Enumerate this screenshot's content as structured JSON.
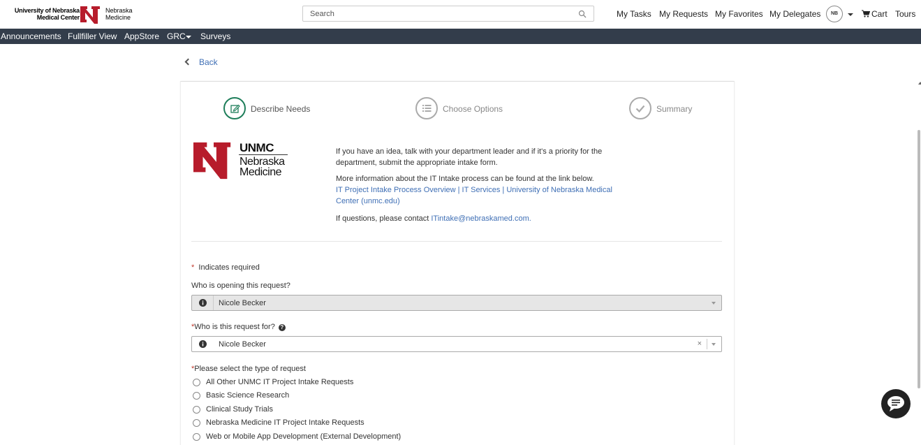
{
  "header": {
    "logo_left_line1": "University of Nebraska",
    "logo_left_line2": "Medical Center",
    "logo_right_line1": "Nebraska",
    "logo_right_line2": "Medicine",
    "search_placeholder": "Search",
    "nav": [
      "My Tasks",
      "My Requests",
      "My Favorites",
      "My Delegates"
    ],
    "avatar_initials": "NB",
    "cart_label": "Cart",
    "tours_label": "Tours"
  },
  "subnav": {
    "items": [
      "Announcements",
      "Fullfiller View",
      "AppStore",
      "GRC",
      "Surveys"
    ]
  },
  "back_label": "Back",
  "steps": [
    {
      "label": "Describe Needs"
    },
    {
      "label": "Choose Options"
    },
    {
      "label": "Summary"
    }
  ],
  "intro": {
    "logo_unmc": "UNMC",
    "logo_nm_line1": "Nebraska",
    "logo_nm_line2": "Medicine",
    "p1": "If you have an idea, talk with your department leader and if it's a priority for the department, submit the appropriate intake form.",
    "p2": "More information about the IT Intake process can be found at the link below.",
    "link": "IT Project Intake Process Overview | IT Services | University of Nebraska Medical Center (unmc.edu)",
    "p3_prefix": "If questions, please contact ",
    "email": "ITintake@nebraskamed.com."
  },
  "form": {
    "required_note": "Indicates required",
    "opened_by_label": "Who is opening this request?",
    "opened_by_value": "Nicole Becker",
    "request_for_label": "Who is this request for?",
    "request_for_value": "Nicole Becker",
    "clear_symbol": "×",
    "type_label": "Please select the type of request",
    "type_options": [
      "All Other UNMC IT Project Intake Requests",
      "Basic Science Research",
      "Clinical Study Trials",
      "Nebraska Medicine IT Project Intake Requests",
      "Web or Mobile App Development (External Development)"
    ]
  },
  "colors": {
    "nav_bg": "#333d4b",
    "link": "#3f6fb5",
    "active_step": "#1e7e5a",
    "brand_red": "#b71c2b",
    "required": "#c0392b"
  },
  "icons": [
    "search-icon",
    "cart-icon",
    "chevron-left-icon",
    "edit-icon",
    "list-icon",
    "check-icon",
    "info-icon",
    "question-icon",
    "chat-icon"
  ]
}
